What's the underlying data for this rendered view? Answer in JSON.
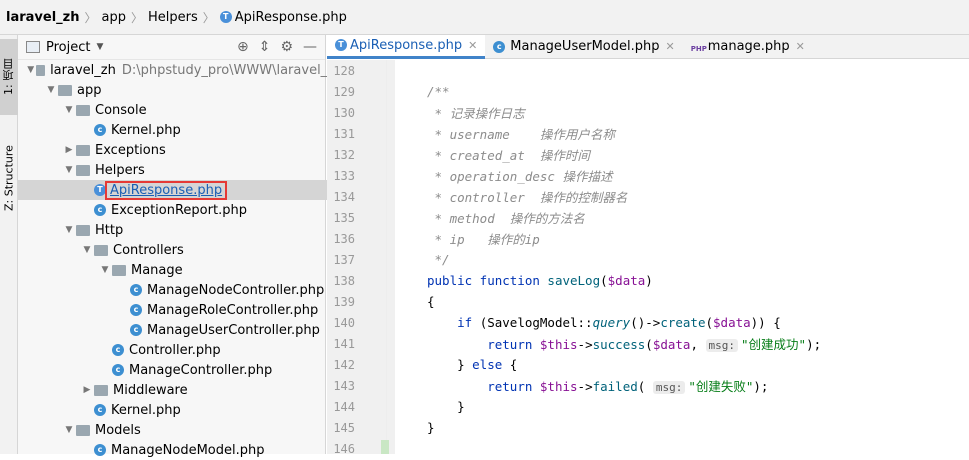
{
  "breadcrumb": [
    "laravel_zh",
    "app",
    "Helpers",
    "ApiResponse.php"
  ],
  "left_strip": {
    "project_tab": "1: 项目",
    "structure_tab": "Z: Structure"
  },
  "project_panel": {
    "title": "Project",
    "tree": [
      {
        "label": "laravel_zh",
        "path": "D:\\phpstudy_pro\\WWW\\laravel_z",
        "kind": "folder",
        "depth": 0,
        "open": true
      },
      {
        "label": "app",
        "kind": "folder",
        "depth": 1,
        "open": true
      },
      {
        "label": "Console",
        "kind": "folder",
        "depth": 2,
        "open": true
      },
      {
        "label": "Kernel.php",
        "kind": "class",
        "depth": 3
      },
      {
        "label": "Exceptions",
        "kind": "folder",
        "depth": 2,
        "open": false
      },
      {
        "label": "Helpers",
        "kind": "folder",
        "depth": 2,
        "open": true
      },
      {
        "label": "ApiResponse.php",
        "kind": "trait",
        "depth": 3,
        "selected": true
      },
      {
        "label": "ExceptionReport.php",
        "kind": "class",
        "depth": 3
      },
      {
        "label": "Http",
        "kind": "folder",
        "depth": 2,
        "open": true
      },
      {
        "label": "Controllers",
        "kind": "folder",
        "depth": 3,
        "open": true
      },
      {
        "label": "Manage",
        "kind": "folder",
        "depth": 4,
        "open": true
      },
      {
        "label": "ManageNodeController.php",
        "kind": "class",
        "depth": 5
      },
      {
        "label": "ManageRoleController.php",
        "kind": "class",
        "depth": 5
      },
      {
        "label": "ManageUserController.php",
        "kind": "class",
        "depth": 5
      },
      {
        "label": "Controller.php",
        "kind": "class",
        "depth": 4
      },
      {
        "label": "ManageController.php",
        "kind": "class",
        "depth": 4
      },
      {
        "label": "Middleware",
        "kind": "folder",
        "depth": 3,
        "open": false
      },
      {
        "label": "Kernel.php",
        "kind": "class",
        "depth": 3
      },
      {
        "label": "Models",
        "kind": "folder",
        "depth": 2,
        "open": true
      },
      {
        "label": "ManageNodeModel.php",
        "kind": "class",
        "depth": 3
      }
    ]
  },
  "editor_tabs": [
    {
      "label": "ApiResponse.php",
      "icon": "trait-icon",
      "active": true
    },
    {
      "label": "ManageUserModel.php",
      "icon": "class-icon",
      "active": false
    },
    {
      "label": "manage.php",
      "icon": "php-file-icon",
      "active": false
    }
  ],
  "code_lines": [
    {
      "n": "128",
      "html": ""
    },
    {
      "n": "129",
      "html": "<span class='cm'>/**</span>"
    },
    {
      "n": "130",
      "html": "<span class='cm'> * 记录操作日志</span>"
    },
    {
      "n": "131",
      "html": "<span class='cm'> * username    操作用户名称</span>"
    },
    {
      "n": "132",
      "html": "<span class='cm'> * created_at  操作时间</span>"
    },
    {
      "n": "133",
      "html": "<span class='cm'> * operation_desc 操作描述</span>"
    },
    {
      "n": "134",
      "html": "<span class='cm'> * controller  操作的控制器名</span>"
    },
    {
      "n": "135",
      "html": "<span class='cm'> * method  操作的方法名</span>"
    },
    {
      "n": "136",
      "html": "<span class='cm'> * ip   操作的ip</span>"
    },
    {
      "n": "137",
      "html": "<span class='cm'> */</span>"
    },
    {
      "n": "138",
      "html": "<span class='kw'>public function </span><span class='fn'>saveLog</span>(<span class='var'>$data</span>)"
    },
    {
      "n": "139",
      "html": "{"
    },
    {
      "n": "140",
      "html": "    <span class='kw'>if </span>(SavelogModel::<span class='it'>query</span>()-><span class='fn'>create</span>(<span class='var'>$data</span>)) {"
    },
    {
      "n": "141",
      "html": "        <span class='kw'>return </span><span class='var'>$this</span>-><span class='fn'>success</span>(<span class='var'>$data</span>, <span class='hint'>msg:</span><span class='str'>\"创建成功\"</span>);"
    },
    {
      "n": "142",
      "html": "    } <span class='kw'>else </span>{"
    },
    {
      "n": "143",
      "html": "        <span class='kw'>return </span><span class='var'>$this</span>-><span class='fn'>failed</span>( <span class='hint'>msg:</span><span class='str'>\"创建失败\"</span>);"
    },
    {
      "n": "144",
      "html": "    }"
    },
    {
      "n": "145",
      "html": "}"
    },
    {
      "n": "146",
      "html": ""
    }
  ]
}
